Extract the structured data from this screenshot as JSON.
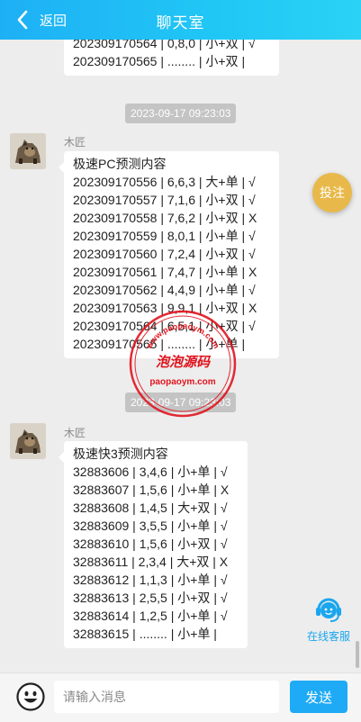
{
  "header": {
    "back_label": "返回",
    "title": "聊天室"
  },
  "messages": [
    {
      "lines": [
        "202309170564 | 0,8,0 | 小+双 | √",
        "202309170565 | ........ | 小+双 |"
      ]
    },
    {
      "timestamp": "2023-09-17 09:23:03",
      "sender": "木匠",
      "lines": [
        "极速PC预测内容",
        "202309170556 | 6,6,3 | 大+单 | √",
        "202309170557 | 7,1,6 | 小+双 | √",
        "202309170558 | 7,6,2 | 小+双 | X",
        "202309170559 | 8,0,1 | 小+单 | √",
        "202309170560 | 7,2,4 | 小+双 | √",
        "202309170561 | 7,4,7 | 小+单 | X",
        "202309170562 | 4,4,9 | 小+单 | √",
        "202309170563 | 9,9,1 | 小+双 | X",
        "202309170564 | 6,5,1 | 小+双 | √",
        "202309170565 | ........ | 小+单 |"
      ]
    },
    {
      "timestamp": "2023-09-17 09:23:03",
      "sender": "木匠",
      "lines": [
        "极速快3预测内容",
        "32883606 | 3,4,6 | 小+单 | √",
        "32883607 | 1,5,6 | 小+单 | X",
        "32883608 | 1,4,5 | 大+双 | √",
        "32883609 | 3,5,5 | 小+单 | √",
        "32883610 | 1,5,6 | 小+双 | √",
        "32883611 | 2,3,4 | 大+双 | X",
        "32883612 | 1,1,3 | 小+单 | √",
        "32883613 | 2,5,5 | 小+双 | √",
        "32883614 | 1,2,5 | 小+单 | √",
        "32883615 | ........ | 小+单 |"
      ]
    }
  ],
  "floating": {
    "bet_label": "投注",
    "service_label": "在线客服"
  },
  "footer": {
    "input_placeholder": "请输入消息",
    "send_label": "发送"
  },
  "watermark": {
    "arc_text": "www.paopaoym.com",
    "cn_text": "泡泡源码",
    "domain_text": "paopaoym.com"
  },
  "colors": {
    "header": "#1eb0f5",
    "accent": "#1eaaf5",
    "bet_button": "#e8b94a",
    "watermark": "#e0141e",
    "background": "#ededed"
  }
}
